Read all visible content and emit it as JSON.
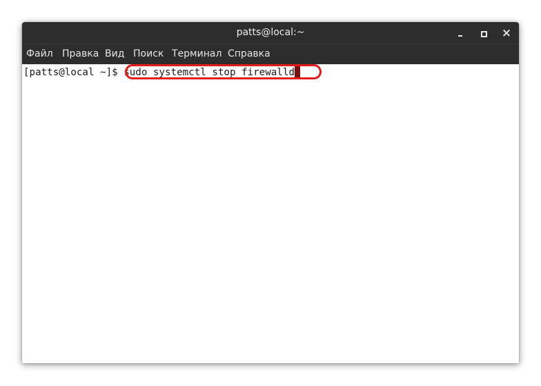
{
  "window": {
    "title": "patts@local:~",
    "controls": {
      "minimize": "minimize-icon",
      "maximize": "maximize-icon",
      "close": "×"
    }
  },
  "menubar": {
    "items": [
      {
        "label": "Файл"
      },
      {
        "label": "Правка"
      },
      {
        "label": "Вид"
      },
      {
        "label": "Поиск"
      },
      {
        "label": "Терминал"
      },
      {
        "label": "Справка"
      }
    ]
  },
  "terminal": {
    "prompt": "[patts@local ~]$ ",
    "command": "sudo systemctl stop firewalld"
  },
  "colors": {
    "titlebar": "#2d2d2d",
    "highlight": "#e11c1c",
    "cursor": "#7a0f0f"
  }
}
